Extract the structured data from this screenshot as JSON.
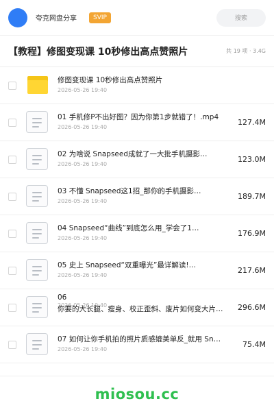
{
  "header": {
    "user_name": "夸克网盘分享",
    "badge": "SVIP",
    "search_placeholder": "搜索",
    "accent_color": "#2f7df6"
  },
  "folder": {
    "title": "【教程】修图变现课 10秒修出高点赞照片",
    "summary": "共 19 项 · 3.4G"
  },
  "files": [
    {
      "type": "folder",
      "name": "修图变现课 10秒修出高点赞照片",
      "date": "2026-05-26 19:40",
      "size": ""
    },
    {
      "type": "file",
      "name": "01 手机修P不出好图？因为你第1步就错了！.mp4",
      "date": "2026-05-26 19:40",
      "size": "127.4M"
    },
    {
      "type": "file",
      "name": "02 为啥说 Snapseed成就了一大批手机摄影…",
      "date": "2026-05-26 19:40",
      "size": "123.0M"
    },
    {
      "type": "file",
      "name": "03 不懂 Snapseed这1招_那你的手机摄影…",
      "date": "2026-05-26 19:40",
      "size": "189.7M"
    },
    {
      "type": "file",
      "name": "04 Snapseed“曲线”到底怎么用_学会了1…",
      "date": "2026-05-26 19:40",
      "size": "176.9M"
    },
    {
      "type": "file",
      "name": "05 史上 Snapseed“双重曝光”最详解读!…",
      "date": "2026-05-26 19:40",
      "size": "217.6M"
    },
    {
      "type": "file",
      "name": "06",
      "name_line2": "你要的大长腿、瘦身、校正歪斜、废片如何变大片…",
      "date": "2026-05-26 19:40",
      "size": "296.6M"
    },
    {
      "type": "file",
      "name": "07 如何让你手机拍的照片质感媲美单反_就用 Sn…",
      "date": "2026-05-26 19:40",
      "size": "75.4M"
    }
  ],
  "watermark": "miosou.cc"
}
